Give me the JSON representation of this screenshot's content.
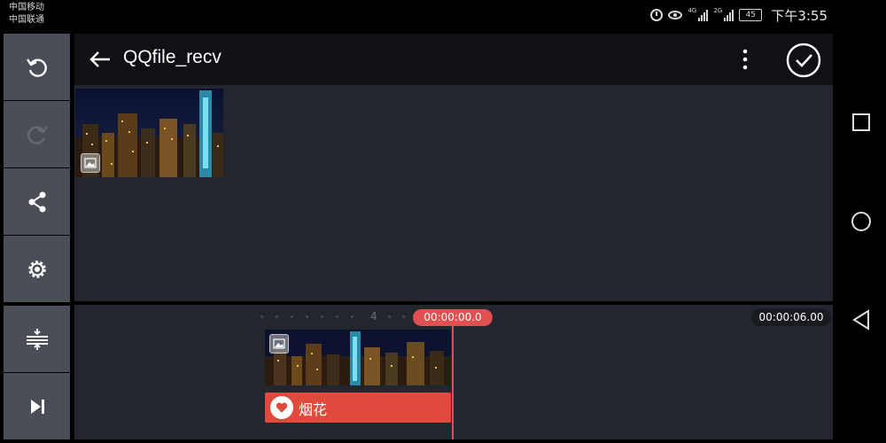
{
  "status_bar": {
    "carrier_1": "中国移动",
    "carrier_2": "中国联通",
    "signal_1_tag": "4G",
    "signal_2_tag": "2G",
    "battery": "45",
    "time": "下午3:55"
  },
  "toolbar": {
    "items": [
      {
        "icon": "undo-icon"
      },
      {
        "icon": "redo-icon"
      },
      {
        "icon": "share-icon"
      },
      {
        "icon": "settings-icon"
      },
      {
        "icon": "track-adjust-icon"
      },
      {
        "icon": "skip-to-end-icon"
      }
    ]
  },
  "header": {
    "title": "QQfile_recv"
  },
  "timeline": {
    "ruler_number": "4",
    "playhead_time": "00:00:00.0",
    "end_time": "00:00:06.00",
    "effect_label": "烟花"
  },
  "colors": {
    "accent": "#e05050",
    "effect_track": "#e04a3c",
    "panel": "#23262c",
    "tool_button": "#4a4f57"
  }
}
